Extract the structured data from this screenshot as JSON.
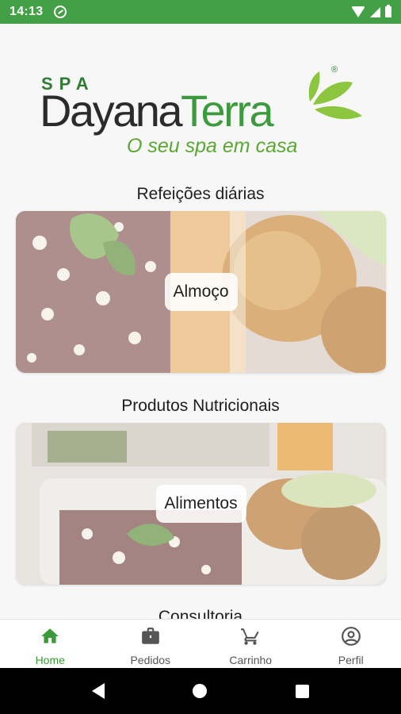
{
  "status_bar": {
    "time": "14:13"
  },
  "logo": {
    "spa": "SPA",
    "name_part1": "Dayana",
    "name_part2": "Terra",
    "registered": "®",
    "tagline": "O seu spa em casa"
  },
  "sections": [
    {
      "title": "Refeições diárias",
      "card_label": "Almoço"
    },
    {
      "title": "Produtos Nutricionais",
      "card_label": "Alimentos"
    },
    {
      "title": "Consultoria"
    }
  ],
  "bottom_nav": {
    "items": [
      {
        "label": "Home",
        "icon": "home-icon",
        "active": true
      },
      {
        "label": "Pedidos",
        "icon": "briefcase-icon",
        "active": false
      },
      {
        "label": "Carrinho",
        "icon": "cart-icon",
        "active": false
      },
      {
        "label": "Perfil",
        "icon": "account-icon",
        "active": false
      }
    ]
  },
  "colors": {
    "status_bar": "#43a047",
    "brand_green": "#3d9a3d",
    "leaf_green": "#8cc63f",
    "active_nav": "#3a9a3a"
  }
}
